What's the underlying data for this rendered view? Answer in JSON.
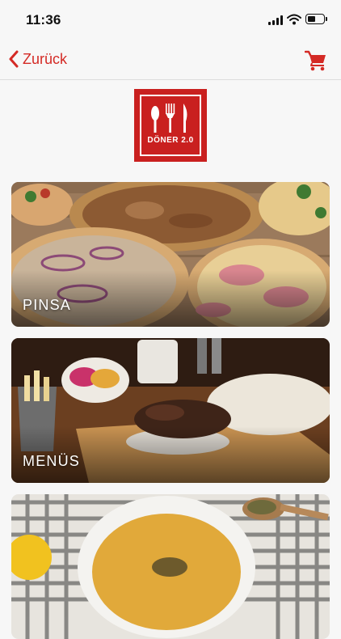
{
  "status_bar": {
    "time": "11:36"
  },
  "nav": {
    "back_label": "Zurück"
  },
  "logo": {
    "brand_text": "DÖNER 2.0"
  },
  "categories": [
    {
      "label": "PINSA"
    },
    {
      "label": "MENÜS"
    },
    {
      "label": ""
    }
  ],
  "colors": {
    "accent": "#d42a25",
    "logo_red": "#c9201f"
  }
}
